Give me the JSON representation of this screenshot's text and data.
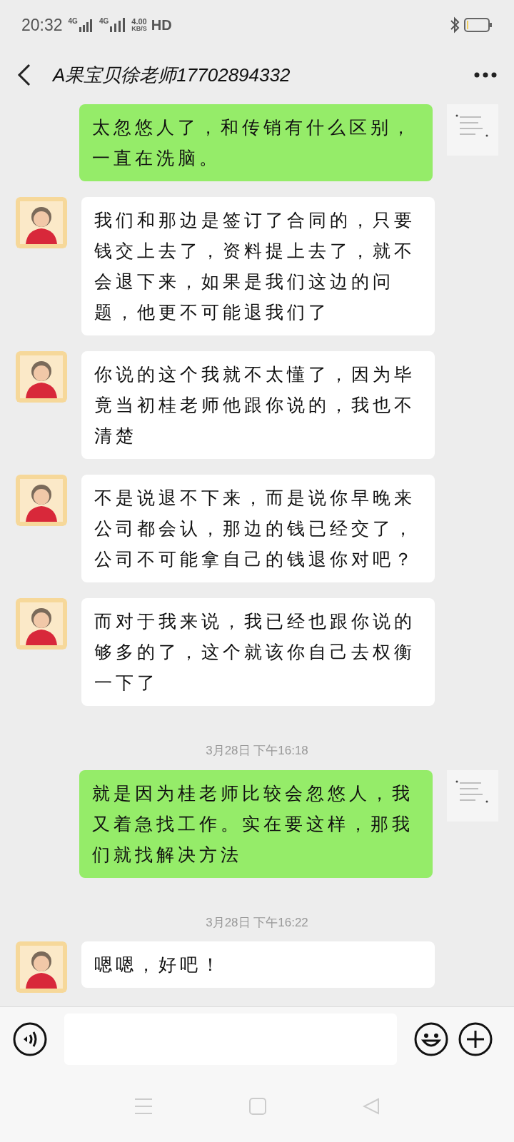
{
  "status_bar": {
    "time": "20:32",
    "network_1": "4G",
    "network_2": "4G",
    "speed": "4.00",
    "speed_unit": "KB/S",
    "hd": "HD"
  },
  "header": {
    "title": "A果宝贝徐老师17702894332"
  },
  "messages": [
    {
      "kind": "sent",
      "text": "太忽悠人了，和传销有什么区别，一直在洗脑。"
    },
    {
      "kind": "received",
      "text": "我们和那边是签订了合同的，只要钱交上去了，资料提上去了，就不会退下来，如果是我们这边的问题，他更不可能退我们了"
    },
    {
      "kind": "received",
      "text": "你说的这个我就不太懂了，因为毕竟当初桂老师他跟你说的，我也不清楚"
    },
    {
      "kind": "received",
      "text": "不是说退不下来，而是说你早晚来公司都会认，那边的钱已经交了，公司不可能拿自己的钱退你对吧？"
    },
    {
      "kind": "received",
      "text": "而对于我来说，我已经也跟你说的够多的了，这个就该你自己去权衡一下了"
    },
    {
      "kind": "time",
      "text": "3月28日 下午16:18"
    },
    {
      "kind": "sent",
      "text": "就是因为桂老师比较会忽悠人，我又着急找工作。实在要这样，那我们就找解决方法"
    },
    {
      "kind": "time",
      "text": "3月28日 下午16:22"
    },
    {
      "kind": "received",
      "text": "嗯嗯，好吧！"
    }
  ]
}
